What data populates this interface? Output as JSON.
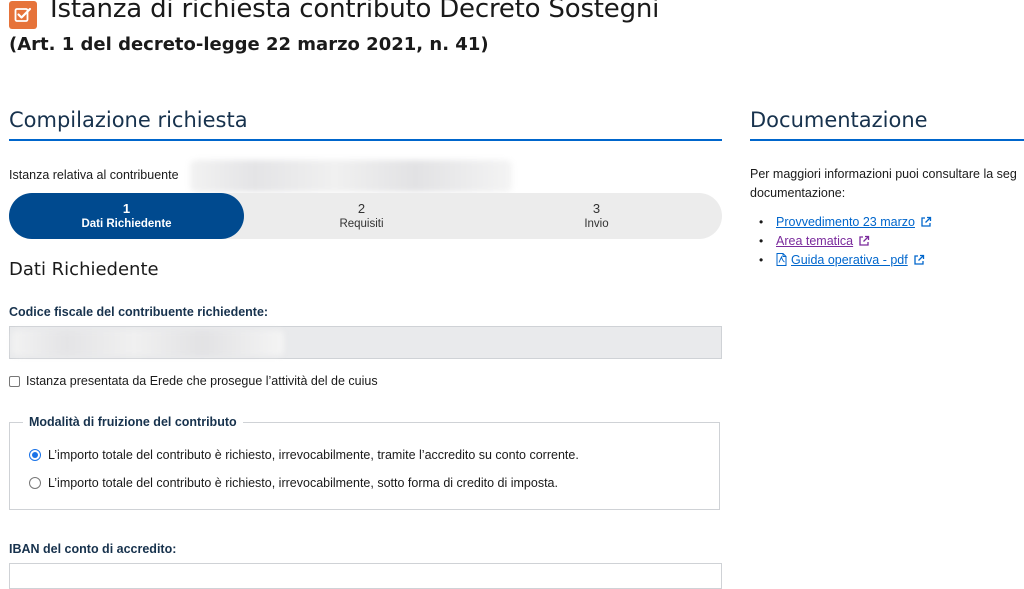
{
  "header": {
    "title": "Istanza di richiesta contributo Decreto Sostegni",
    "subtitle": "(Art. 1 del decreto-legge 22 marzo 2021, n. 41)"
  },
  "form": {
    "heading": "Compilazione richiesta",
    "contribuente_label": "Istanza relativa al contribuente",
    "steps": [
      {
        "number": "1",
        "label": "Dati Richiedente",
        "active": true
      },
      {
        "number": "2",
        "label": "Requisiti",
        "active": false
      },
      {
        "number": "3",
        "label": "Invio",
        "active": false
      }
    ],
    "section_title": "Dati Richiedente",
    "codice_fiscale_label": "Codice fiscale del contribuente richiedente:",
    "erede_checkbox_label": "Istanza presentata da Erede che prosegue l’attività del de cuius",
    "modalita_legend": "Modalità di fruizione del contributo",
    "option_conto": "L’importo totale del contributo è richiesto, irrevocabilmente, tramite l’accredito su conto corrente.",
    "option_credito": "L’importo totale del contributo è richiesto, irrevocabilmente, sotto forma di credito di imposta.",
    "selected_option": "conto",
    "iban_label": "IBAN del conto di accredito:"
  },
  "docs": {
    "heading": "Documentazione",
    "intro": "Per maggiori informazioni puoi consultare la seg documentazione:",
    "intro_line1": "Per maggiori informazioni puoi consultare la seg",
    "intro_line2": "documentazione:",
    "links": [
      {
        "label": "Provvedimento 23 marzo",
        "icon": "external-link-icon"
      },
      {
        "label": "Area tematica",
        "icon": "external-link-icon"
      },
      {
        "label": "Guida operativa - pdf",
        "icon": "external-link-icon",
        "prefix_icon": "pdf-file-icon"
      }
    ]
  },
  "colors": {
    "accent_orange": "#e6733a",
    "primary_blue": "#004a8f",
    "link_blue": "#0066cc",
    "visited_purple": "#7a2a9c",
    "heading_blue": "#17324d"
  }
}
